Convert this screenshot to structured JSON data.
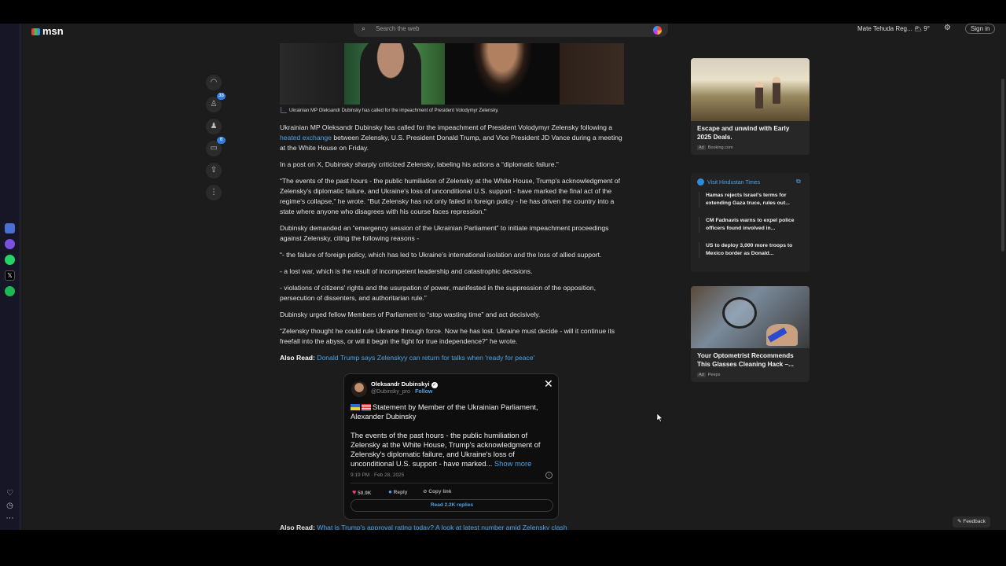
{
  "brand": {
    "name": "msn"
  },
  "search": {
    "placeholder": "Search the web"
  },
  "header": {
    "user": "Mate Tehuda Reg... 🌥 9°",
    "signin": "Sign in"
  },
  "actions": {
    "likes_badge": "38",
    "comments_badge": "6"
  },
  "article": {
    "caption": "Ukrainian MP Oleksandr Dubinsky has called for the impeachment of President Volodymyr Zelensky.",
    "p1_a": "Ukrainian MP Oleksandr Dubinsky has called for the impeachment of President Volodymyr Zelensky following a ",
    "p1_link": "heated exchange",
    "p1_b": " between Zelensky, U.S. President Donald Trump, and Vice President JD Vance during a meeting at the White House on Friday.",
    "p2": "In a post on X, Dubinsky sharply criticized Zelensky, labeling his actions a “diplomatic failure.”",
    "p3": "“The events of the past hours - the public humiliation of Zelensky at the White House, Trump's acknowledgment of Zelensky's diplomatic failure, and Ukraine's loss of unconditional U.S. support - have marked the final act of the regime's collapse,” he wrote. “But Zelensky has not only failed in foreign policy - he has driven the country into a state where anyone who disagrees with his course faces repression.”",
    "p4": "Dubinsky demanded an “emergency session of the Ukrainian Parliament” to initiate impeachment proceedings against Zelensky, citing the following reasons -",
    "p5": "“- the failure of foreign policy, which has led to Ukraine's international isolation and the loss of allied support.",
    "p6": "- a lost war, which is the result of incompetent leadership and catastrophic decisions.",
    "p7": "- violations of citizens' rights and the usurpation of power, manifested in the suppression of the opposition, persecution of dissenters, and authoritarian rule.”",
    "p8": "Dubinsky urged fellow Members of Parliament to “stop wasting time” and act decisively.",
    "p9": "“Zelensky thought he could rule Ukraine through force. Now he has lost. Ukraine must decide - will it continue its freefall into the abyss, or will it begin the fight for true independence?” he wrote.",
    "also_label": "Also Read:",
    "also_link": "Donald Trump says Zelenskyy can return for talks when 'ready for peace'",
    "also2_link": "What is Trump's approval rating today? A look at latest number amid Zelensky clash"
  },
  "tweet": {
    "name": "Oleksandr Dubinskyi",
    "handle": "@Dubinsky_pro",
    "dot": "·",
    "follow": "Follow",
    "title": "Statement by Member of the Ukrainian Parliament, Alexander Dubinsky",
    "body": "The events of the past hours - the public humiliation of Zelensky at the White House, Trump's acknowledgment of Zelensky's diplomatic failure, and Ukraine's loss of unconditional U.S. support - have marked...",
    "show_more": "Show more",
    "time": "9:19 PM · Feb 28, 2025",
    "likes": "50.9K",
    "reply": "Reply",
    "copy": "Copy link",
    "read_replies": "Read 2.2K replies"
  },
  "sidebar": {
    "ad1": {
      "title": "Escape and unwind with Early 2025 Deals.",
      "ad": "Ad",
      "source": "Booking.com"
    },
    "news": {
      "source": "Visit Hindustan Times",
      "items": [
        "Hamas rejects Israel's terms for extending Gaza truce, rules out...",
        "CM Fadnavis warns to expel police officers found involved in...",
        "US to deploy 3,000 more troops to Mexico border as Donald..."
      ]
    },
    "ad2": {
      "title": "Your Optometrist Recommends This Glasses Cleaning Hack –...",
      "ad": "Ad",
      "source": "Peeps"
    }
  },
  "feedback": "Feedback",
  "colors": {
    "link": "#4aa3ea",
    "background": "#1c1c1c",
    "card": "#272727"
  }
}
